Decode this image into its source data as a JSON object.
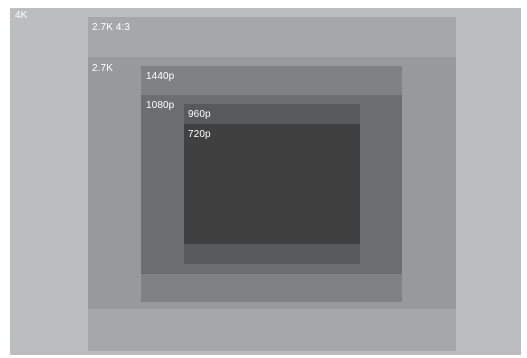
{
  "diagram": {
    "frames": [
      {
        "id": "4k",
        "label": "4K",
        "color": "#bcbdbf"
      },
      {
        "id": "2-7k-4-3",
        "label": "2.7K 4:3",
        "color": "#a6a7a9"
      },
      {
        "id": "2-7k",
        "label": "2.7K",
        "color": "#98999b"
      },
      {
        "id": "1440p",
        "label": "1440p",
        "color": "#808183"
      },
      {
        "id": "1080p",
        "label": "1080p",
        "color": "#6d6e70"
      },
      {
        "id": "960p",
        "label": "960p",
        "color": "#58595b"
      },
      {
        "id": "720p",
        "label": "720p",
        "color": "#404041"
      }
    ]
  }
}
